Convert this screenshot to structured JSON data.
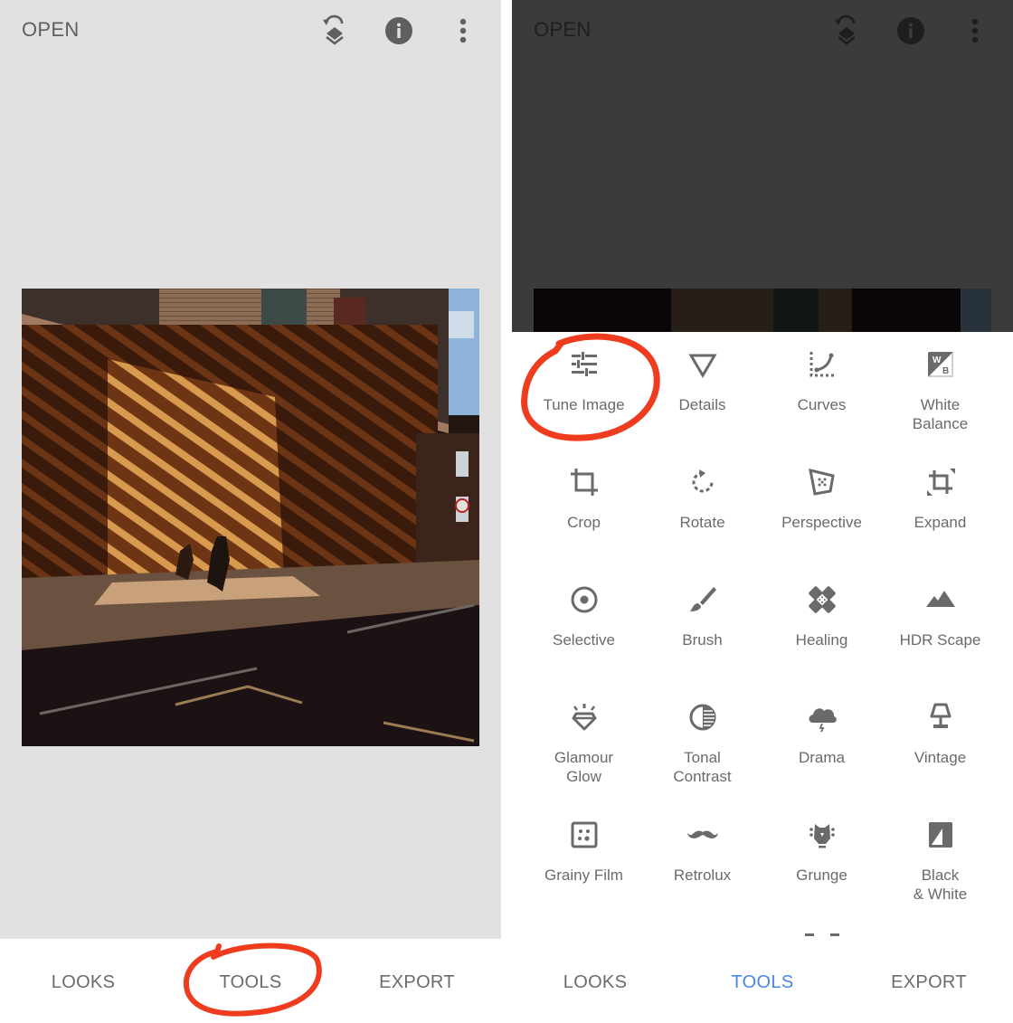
{
  "left_screen": {
    "topbar": {
      "open_label": "OPEN",
      "icons": [
        "undo-stack-icon",
        "info-icon",
        "more-vert-icon"
      ]
    },
    "photo": {
      "description": "Street photo: sunlit diagonal wooden-slat wall under a brick building, two pedestrians walking on the sidewalk, dark road in foreground"
    },
    "bottom_nav": {
      "tabs": [
        {
          "label": "LOOKS",
          "active": false
        },
        {
          "label": "TOOLS",
          "active": false,
          "highlighted_by_annotation": true
        },
        {
          "label": "EXPORT",
          "active": false
        }
      ]
    }
  },
  "right_screen": {
    "topbar": {
      "open_label": "OPEN",
      "icons": [
        "undo-stack-icon",
        "info-icon",
        "more-vert-icon"
      ]
    },
    "tools": [
      {
        "label": "Tune Image",
        "icon": "sliders-icon",
        "highlighted_by_annotation": true
      },
      {
        "label": "Details",
        "icon": "triangle-down-icon"
      },
      {
        "label": "Curves",
        "icon": "curves-icon"
      },
      {
        "label": "White\nBalance",
        "icon": "white-balance-icon"
      },
      {
        "label": "Crop",
        "icon": "crop-icon"
      },
      {
        "label": "Rotate",
        "icon": "rotate-icon"
      },
      {
        "label": "Perspective",
        "icon": "perspective-icon"
      },
      {
        "label": "Expand",
        "icon": "expand-icon"
      },
      {
        "label": "Selective",
        "icon": "selective-icon"
      },
      {
        "label": "Brush",
        "icon": "brush-icon"
      },
      {
        "label": "Healing",
        "icon": "healing-icon"
      },
      {
        "label": "HDR Scape",
        "icon": "mountains-icon"
      },
      {
        "label": "Glamour\nGlow",
        "icon": "diamond-icon"
      },
      {
        "label": "Tonal\nContrast",
        "icon": "tonal-contrast-icon"
      },
      {
        "label": "Drama",
        "icon": "storm-cloud-icon"
      },
      {
        "label": "Vintage",
        "icon": "lamp-icon"
      },
      {
        "label": "Grainy Film",
        "icon": "grain-icon"
      },
      {
        "label": "Retrolux",
        "icon": "mustache-icon"
      },
      {
        "label": "Grunge",
        "icon": "guitar-head-icon"
      },
      {
        "label": "Black\n& White",
        "icon": "black-white-icon"
      }
    ],
    "bottom_nav": {
      "tabs": [
        {
          "label": "LOOKS",
          "active": false
        },
        {
          "label": "TOOLS",
          "active": true
        },
        {
          "label": "EXPORT",
          "active": false
        }
      ]
    }
  },
  "colors": {
    "active_tab": "#4a86e8",
    "annotation": "#f03c1e",
    "icon_gray": "#6a6a6a",
    "left_canvas_bg": "#e1e1e1",
    "right_canvas_bg": "#3b3b3b"
  }
}
